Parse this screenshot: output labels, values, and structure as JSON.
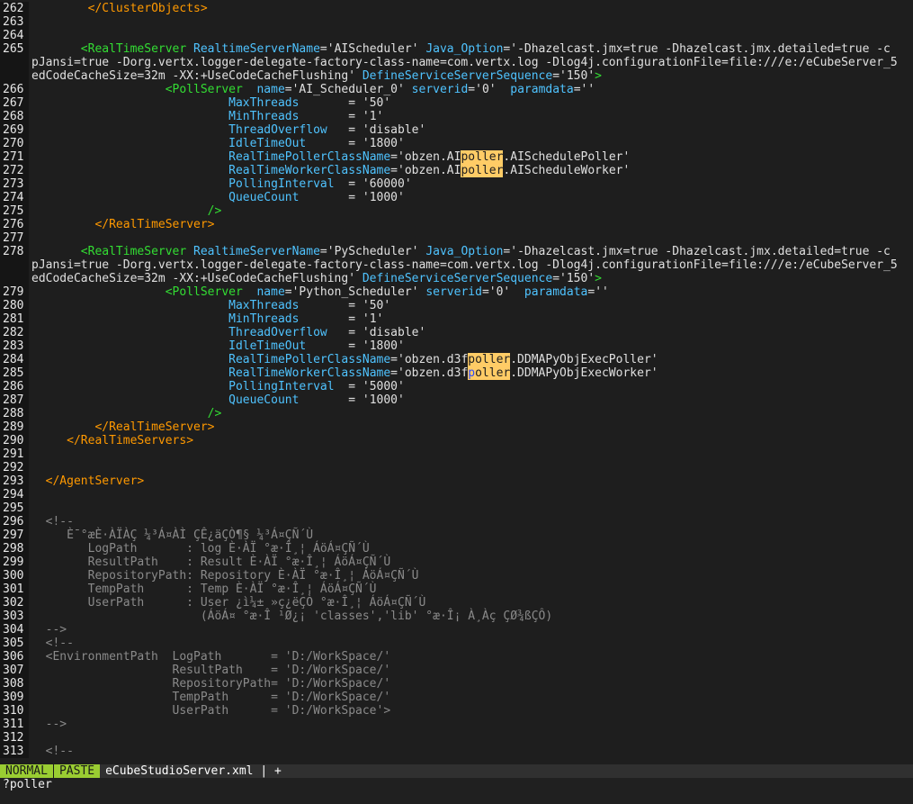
{
  "lines": [
    {
      "n": "262",
      "parts": [
        {
          "c": "plain",
          "t": "        "
        },
        {
          "c": "tag",
          "t": "</ClusterObjects>"
        }
      ]
    },
    {
      "n": "263",
      "parts": []
    },
    {
      "n": "264",
      "parts": []
    },
    {
      "n": "265",
      "parts": [
        {
          "c": "plain",
          "t": "       "
        },
        {
          "c": "ptag",
          "t": "<RealTimeServer "
        },
        {
          "c": "attr",
          "t": "RealtimeServerName"
        },
        {
          "c": "val",
          "t": "='AIScheduler' "
        },
        {
          "c": "attr",
          "t": "Java_Option"
        },
        {
          "c": "val",
          "t": "='-Dhazelcast.jmx=true -Dhazelcast.jmx.detailed=true -c"
        }
      ]
    },
    {
      "n": "",
      "parts": [
        {
          "c": "val",
          "t": "pJansi=true -Dorg.vertx.logger-delegate-factory-class-name=com.vertx.log -Dlog4j.configurationFile=file:///e:/eCubeServer_5"
        }
      ]
    },
    {
      "n": "",
      "parts": [
        {
          "c": "val",
          "t": "edCodeCacheSize=32m -XX:+UseCodeCacheFlushing' "
        },
        {
          "c": "attr",
          "t": "DefineServiceServerSequence"
        },
        {
          "c": "val",
          "t": "='150'"
        },
        {
          "c": "ptag",
          "t": ">"
        }
      ]
    },
    {
      "n": "266",
      "parts": [
        {
          "c": "plain",
          "t": "                   "
        },
        {
          "c": "ptag",
          "t": "<PollServer  "
        },
        {
          "c": "attr",
          "t": "name"
        },
        {
          "c": "val",
          "t": "='AI_Scheduler_0' "
        },
        {
          "c": "attr",
          "t": "serverid"
        },
        {
          "c": "val",
          "t": "='0'  "
        },
        {
          "c": "attr",
          "t": "paramdata"
        },
        {
          "c": "val",
          "t": "=''"
        }
      ]
    },
    {
      "n": "267",
      "parts": [
        {
          "c": "plain",
          "t": "                            "
        },
        {
          "c": "attr",
          "t": "MaxThreads"
        },
        {
          "c": "val",
          "t": "       = '50'"
        }
      ]
    },
    {
      "n": "268",
      "parts": [
        {
          "c": "plain",
          "t": "                            "
        },
        {
          "c": "attr",
          "t": "MinThreads"
        },
        {
          "c": "val",
          "t": "       = '1'"
        }
      ]
    },
    {
      "n": "269",
      "parts": [
        {
          "c": "plain",
          "t": "                            "
        },
        {
          "c": "attr",
          "t": "ThreadOverflow"
        },
        {
          "c": "val",
          "t": "   = 'disable'"
        }
      ]
    },
    {
      "n": "270",
      "parts": [
        {
          "c": "plain",
          "t": "                            "
        },
        {
          "c": "attr",
          "t": "IdleTimeOut"
        },
        {
          "c": "val",
          "t": "      = '1800'"
        }
      ]
    },
    {
      "n": "271",
      "parts": [
        {
          "c": "plain",
          "t": "                            "
        },
        {
          "c": "attr",
          "t": "RealTimePollerClassName"
        },
        {
          "c": "val",
          "t": "='obzen.AI"
        },
        {
          "c": "hl",
          "t": "poller"
        },
        {
          "c": "val",
          "t": ".AISchedulePoller'"
        }
      ]
    },
    {
      "n": "272",
      "parts": [
        {
          "c": "plain",
          "t": "                            "
        },
        {
          "c": "attr",
          "t": "RealTimeWorkerClassName"
        },
        {
          "c": "val",
          "t": "='obzen.AI"
        },
        {
          "c": "hl",
          "t": "poller"
        },
        {
          "c": "val",
          "t": ".AIScheduleWorker'"
        }
      ]
    },
    {
      "n": "273",
      "parts": [
        {
          "c": "plain",
          "t": "                            "
        },
        {
          "c": "attr",
          "t": "PollingInterval"
        },
        {
          "c": "val",
          "t": "  = '60000'"
        }
      ]
    },
    {
      "n": "274",
      "parts": [
        {
          "c": "plain",
          "t": "                            "
        },
        {
          "c": "attr",
          "t": "QueueCount"
        },
        {
          "c": "val",
          "t": "       = '1000'"
        }
      ]
    },
    {
      "n": "275",
      "parts": [
        {
          "c": "plain",
          "t": "                         "
        },
        {
          "c": "ptag",
          "t": "/>"
        }
      ]
    },
    {
      "n": "276",
      "parts": [
        {
          "c": "plain",
          "t": "         "
        },
        {
          "c": "tag",
          "t": "</RealTimeServer>"
        }
      ]
    },
    {
      "n": "277",
      "parts": []
    },
    {
      "n": "278",
      "parts": [
        {
          "c": "plain",
          "t": "       "
        },
        {
          "c": "ptag",
          "t": "<RealTimeServer "
        },
        {
          "c": "attr",
          "t": "RealtimeServerName"
        },
        {
          "c": "val",
          "t": "='PyScheduler' "
        },
        {
          "c": "attr",
          "t": "Java_Option"
        },
        {
          "c": "val",
          "t": "='-Dhazelcast.jmx=true -Dhazelcast.jmx.detailed=true -c"
        }
      ]
    },
    {
      "n": "",
      "parts": [
        {
          "c": "val",
          "t": "pJansi=true -Dorg.vertx.logger-delegate-factory-class-name=com.vertx.log -Dlog4j.configurationFile=file:///e:/eCubeServer_5"
        }
      ]
    },
    {
      "n": "",
      "parts": [
        {
          "c": "val",
          "t": "edCodeCacheSize=32m -XX:+UseCodeCacheFlushing' "
        },
        {
          "c": "attr",
          "t": "DefineServiceServerSequence"
        },
        {
          "c": "val",
          "t": "='150'"
        },
        {
          "c": "ptag",
          "t": ">"
        }
      ]
    },
    {
      "n": "279",
      "parts": [
        {
          "c": "plain",
          "t": "                   "
        },
        {
          "c": "ptag",
          "t": "<PollServer  "
        },
        {
          "c": "attr",
          "t": "name"
        },
        {
          "c": "val",
          "t": "='Python_Scheduler' "
        },
        {
          "c": "attr",
          "t": "serverid"
        },
        {
          "c": "val",
          "t": "='0'  "
        },
        {
          "c": "attr",
          "t": "paramdata"
        },
        {
          "c": "val",
          "t": "=''"
        }
      ]
    },
    {
      "n": "280",
      "parts": [
        {
          "c": "plain",
          "t": "                            "
        },
        {
          "c": "attr",
          "t": "MaxThreads"
        },
        {
          "c": "val",
          "t": "       = '50'"
        }
      ]
    },
    {
      "n": "281",
      "parts": [
        {
          "c": "plain",
          "t": "                            "
        },
        {
          "c": "attr",
          "t": "MinThreads"
        },
        {
          "c": "val",
          "t": "       = '1'"
        }
      ]
    },
    {
      "n": "282",
      "parts": [
        {
          "c": "plain",
          "t": "                            "
        },
        {
          "c": "attr",
          "t": "ThreadOverflow"
        },
        {
          "c": "val",
          "t": "   = 'disable'"
        }
      ]
    },
    {
      "n": "283",
      "parts": [
        {
          "c": "plain",
          "t": "                            "
        },
        {
          "c": "attr",
          "t": "IdleTimeOut"
        },
        {
          "c": "val",
          "t": "      = '1800'"
        }
      ]
    },
    {
      "n": "284",
      "parts": [
        {
          "c": "plain",
          "t": "                            "
        },
        {
          "c": "attr",
          "t": "RealTimePollerClassName"
        },
        {
          "c": "val",
          "t": "='obzen.d3f"
        },
        {
          "c": "hl",
          "t": "poller"
        },
        {
          "c": "val",
          "t": ".DDMAPyObjExecPoller'"
        }
      ]
    },
    {
      "n": "285",
      "parts": [
        {
          "c": "plain",
          "t": "                            "
        },
        {
          "c": "attr",
          "t": "RealTimeWorkerClassName"
        },
        {
          "c": "val",
          "t": "='obzen.d3f"
        },
        {
          "c": "cur",
          "t": "p"
        },
        {
          "c": "hl",
          "t": "oller"
        },
        {
          "c": "val",
          "t": ".DDMAPyObjExecWorker'"
        }
      ]
    },
    {
      "n": "286",
      "parts": [
        {
          "c": "plain",
          "t": "                            "
        },
        {
          "c": "attr",
          "t": "PollingInterval"
        },
        {
          "c": "val",
          "t": "  = '5000'"
        }
      ]
    },
    {
      "n": "287",
      "parts": [
        {
          "c": "plain",
          "t": "                            "
        },
        {
          "c": "attr",
          "t": "QueueCount"
        },
        {
          "c": "val",
          "t": "       = '1000'"
        }
      ]
    },
    {
      "n": "288",
      "parts": [
        {
          "c": "plain",
          "t": "                         "
        },
        {
          "c": "ptag",
          "t": "/>"
        }
      ]
    },
    {
      "n": "289",
      "parts": [
        {
          "c": "plain",
          "t": "         "
        },
        {
          "c": "tag",
          "t": "</RealTimeServer>"
        }
      ]
    },
    {
      "n": "290",
      "parts": [
        {
          "c": "plain",
          "t": "     "
        },
        {
          "c": "tag",
          "t": "</RealTimeServers>"
        }
      ]
    },
    {
      "n": "291",
      "parts": []
    },
    {
      "n": "292",
      "parts": []
    },
    {
      "n": "293",
      "parts": [
        {
          "c": "plain",
          "t": "  "
        },
        {
          "c": "tag",
          "t": "</AgentServer>"
        }
      ]
    },
    {
      "n": "294",
      "parts": []
    },
    {
      "n": "295",
      "parts": []
    },
    {
      "n": "296",
      "parts": [
        {
          "c": "cmt",
          "t": "  <!--"
        }
      ]
    },
    {
      "n": "297",
      "parts": [
        {
          "c": "cmt",
          "t": "     È¯°æÈ·ÀÏÀÇ ¼³Á¤ÀÌ ÇÊ¿äÇÒ¶§ ¼³Á¤ÇÑ´Ù"
        }
      ]
    },
    {
      "n": "298",
      "parts": [
        {
          "c": "cmt",
          "t": "        LogPath       : log È·ÀÏ °æ·Î¸¦ ÁöÁ¤ÇÑ´Ù"
        }
      ]
    },
    {
      "n": "299",
      "parts": [
        {
          "c": "cmt",
          "t": "        ResultPath    : Result È·ÀÏ °æ·Î¸¦ ÁöÁ¤ÇÑ´Ù"
        }
      ]
    },
    {
      "n": "300",
      "parts": [
        {
          "c": "cmt",
          "t": "        RepositoryPath: Repository È·ÀÏ °æ·Î¸¦ ÁöÁ¤ÇÑ´Ù"
        }
      ]
    },
    {
      "n": "301",
      "parts": [
        {
          "c": "cmt",
          "t": "        TempPath      : Temp È·ÀÏ °æ·Î¸¦ ÁöÁ¤ÇÑ´Ù"
        }
      ]
    },
    {
      "n": "302",
      "parts": [
        {
          "c": "cmt",
          "t": "        UserPath      : User ¿ì¼± »ç¿ëÇÒ °æ·Î¸¦ ÁöÁ¤ÇÑ´Ù"
        }
      ]
    },
    {
      "n": "303",
      "parts": [
        {
          "c": "cmt",
          "t": "                        (ÁöÁ¤ °æ·Î ¹Ø¿¡ 'classes','lib' °æ·Î¡ À¸Àç ÇØ¾ßÇÔ)"
        }
      ]
    },
    {
      "n": "304",
      "parts": [
        {
          "c": "cmt",
          "t": "  -->"
        }
      ]
    },
    {
      "n": "305",
      "parts": [
        {
          "c": "cmt",
          "t": "  <!--"
        }
      ]
    },
    {
      "n": "306",
      "parts": [
        {
          "c": "cmt",
          "t": "  <EnvironmentPath  LogPath       = 'D:/WorkSpace/'"
        }
      ]
    },
    {
      "n": "307",
      "parts": [
        {
          "c": "cmt",
          "t": "                    ResultPath    = 'D:/WorkSpace/'"
        }
      ]
    },
    {
      "n": "308",
      "parts": [
        {
          "c": "cmt",
          "t": "                    RepositoryPath= 'D:/WorkSpace/'"
        }
      ]
    },
    {
      "n": "309",
      "parts": [
        {
          "c": "cmt",
          "t": "                    TempPath      = 'D:/WorkSpace/'"
        }
      ]
    },
    {
      "n": "310",
      "parts": [
        {
          "c": "cmt",
          "t": "                    UserPath      = 'D:/WorkSpace'>"
        }
      ]
    },
    {
      "n": "311",
      "parts": [
        {
          "c": "cmt",
          "t": "  -->"
        }
      ]
    },
    {
      "n": "312",
      "parts": []
    },
    {
      "n": "313",
      "parts": [
        {
          "c": "cmt",
          "t": "  <!--"
        }
      ]
    }
  ],
  "status": {
    "mode": "NORMAL",
    "paste": "PASTE",
    "filename": "eCubeStudioServer.xml",
    "sep": "|",
    "plus": "+"
  },
  "cmdline": "?poller"
}
